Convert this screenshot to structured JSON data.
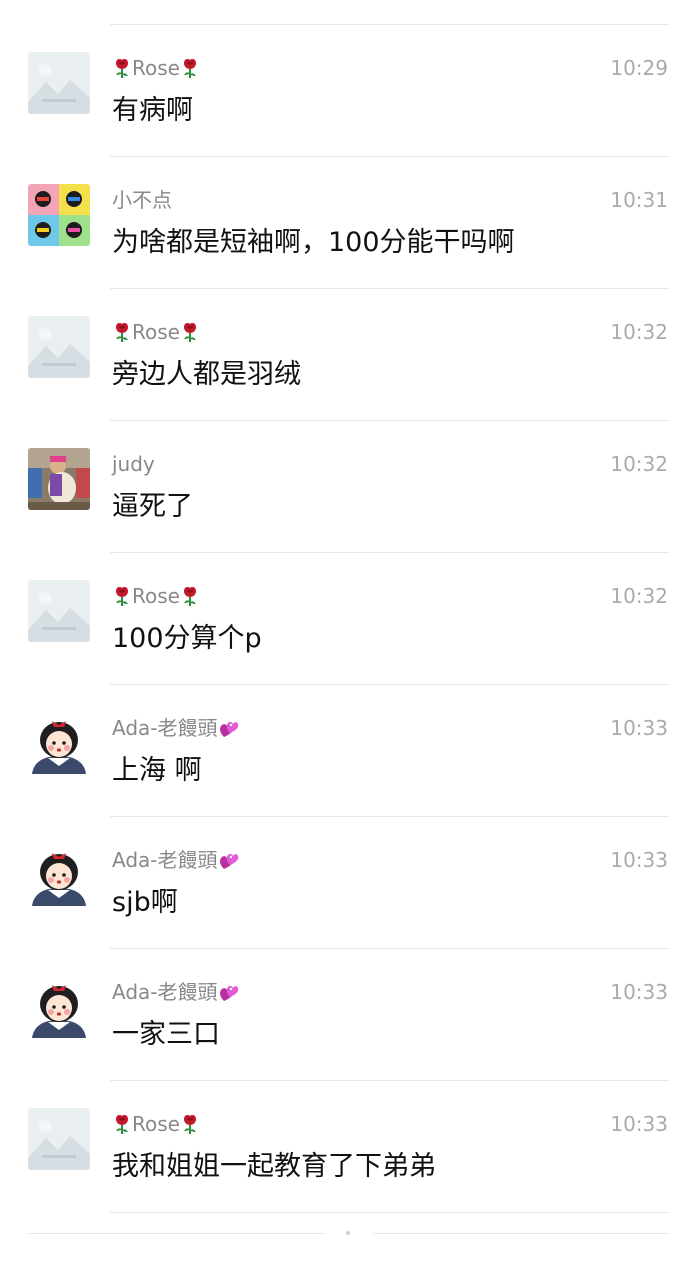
{
  "messages": [
    {
      "sender": "Rose",
      "avatar": "placeholder-image",
      "decoration": "rose-emoji",
      "time": "10:29",
      "text": "有病啊"
    },
    {
      "sender": "小不点",
      "avatar": "four-panel-photo",
      "decoration": "",
      "time": "10:31",
      "text": "为啥都是短袖啊，100分能干吗啊"
    },
    {
      "sender": "Rose",
      "avatar": "placeholder-image",
      "decoration": "rose-emoji",
      "time": "10:32",
      "text": "旁边人都是羽绒"
    },
    {
      "sender": "judy",
      "avatar": "kid-photo",
      "decoration": "",
      "time": "10:32",
      "text": "逼死了"
    },
    {
      "sender": "Rose",
      "avatar": "placeholder-image",
      "decoration": "rose-emoji",
      "time": "10:32",
      "text": "100分算个p"
    },
    {
      "sender": "Ada-老饅頭",
      "avatar": "cartoon-girl",
      "decoration": "heart-emoji",
      "time": "10:33",
      "text": "上海 啊"
    },
    {
      "sender": "Ada-老饅頭",
      "avatar": "cartoon-girl",
      "decoration": "heart-emoji",
      "time": "10:33",
      "text": "sjb啊"
    },
    {
      "sender": "Ada-老饅頭",
      "avatar": "cartoon-girl",
      "decoration": "heart-emoji",
      "time": "10:33",
      "text": "一家三口"
    },
    {
      "sender": "Rose",
      "avatar": "placeholder-image",
      "decoration": "rose-emoji",
      "time": "10:33",
      "text": "我和姐姐一起教育了下弟弟"
    }
  ],
  "colors": {
    "name": "#888888",
    "time": "#aaaaaa",
    "text": "#111111",
    "divider": "#e6e6e6",
    "rose": "#c0182a",
    "heart": "#e35ad6"
  }
}
